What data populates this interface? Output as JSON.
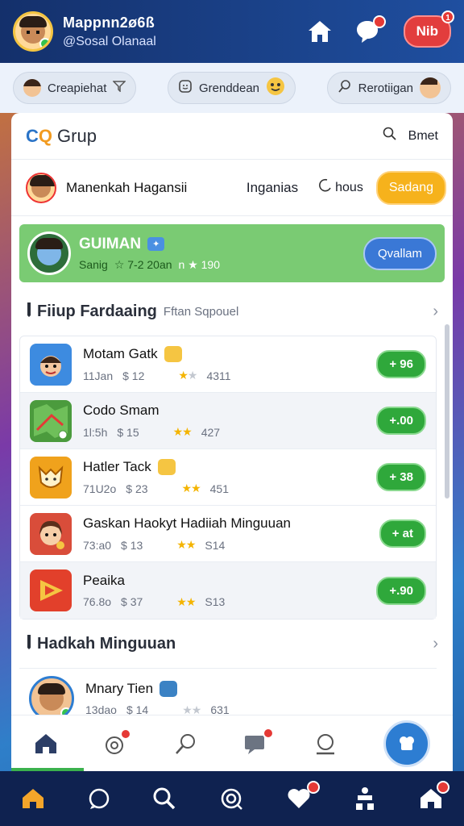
{
  "header": {
    "title": "Mappnn2ø6ß",
    "subtitle": "@Sosal Olanaal",
    "pill_label": "Nib",
    "pill_badge": "1",
    "chat_badge": "",
    "colors": {
      "bar": "#14306b",
      "pill": "#e23d3d"
    }
  },
  "chips": [
    {
      "label": "Creapiehat",
      "icon": "filter-icon"
    },
    {
      "label": "Grenddean",
      "icon": "emoji-icon"
    },
    {
      "label": "Rerotiigan",
      "icon": "search-icon"
    }
  ],
  "panel": {
    "logo_main": "C",
    "logo_accent": "Q",
    "title": "Grup",
    "search_label": "Bmet",
    "profile": {
      "name": "Manenkah Hagansii",
      "status": "Inganias",
      "hours": "hous",
      "button": "Sadang"
    },
    "featured": {
      "name": "GUIMAN",
      "tag": "✦",
      "meta1": "Sanig",
      "meta2": "☆ 7-2 20an",
      "meta3": "n ★ 190",
      "button": "Qvallam"
    },
    "section1": {
      "title": "Fiiup Fardaaing",
      "subtitle": "Fftan Sqpouel"
    },
    "items": [
      {
        "title": "Motam Gatk",
        "time": "11Jan",
        "count": "$ 12",
        "rating": "4311",
        "stars": "1",
        "price": "+ 96",
        "icon": "cartoon-boy-icon",
        "color": "#3d8be0"
      },
      {
        "title": "Codo Smam",
        "time": "1l:5h",
        "count": "$ 15",
        "rating": "427",
        "stars": "2",
        "price": "+.00",
        "icon": "map-icon",
        "color": "#4b9b3d"
      },
      {
        "title": "Hatler Tack",
        "time": "71U2o",
        "count": "$ 23",
        "rating": "451",
        "stars": "2",
        "price": "+ 38",
        "icon": "fox-icon",
        "color": "#f0a21c"
      },
      {
        "title": "Gaskan Haokyt Hadiiah Minguuan",
        "time": "73:a0",
        "count": "$ 13",
        "rating": "S14",
        "stars": "2",
        "price": "+ at",
        "icon": "girl-avatar-icon",
        "color": "#d94d3a"
      },
      {
        "title": "Peaika",
        "time": "76.8o",
        "count": "$ 37",
        "rating": "S13",
        "stars": "2",
        "price": "+.90",
        "icon": "play-icon",
        "color": "#e2402b"
      }
    ],
    "section2": {
      "title": "Hadkah Minguuan"
    },
    "last_item": {
      "title": "Mnary Tien",
      "time": "13dao",
      "count": "$ 14",
      "rating": "631",
      "stars": "1"
    }
  },
  "bottom_nav": [
    "home-icon",
    "game-icon",
    "search-icon",
    "chat-icon",
    "profile-icon",
    "chef-icon"
  ],
  "footer_nav": {
    "items": [
      "home-icon",
      "chat-bubble-icon",
      "search-icon",
      "target-icon",
      "heart-icon",
      "tournament-icon",
      "shop-icon"
    ],
    "heart_badge": "",
    "shop_badge": ""
  }
}
